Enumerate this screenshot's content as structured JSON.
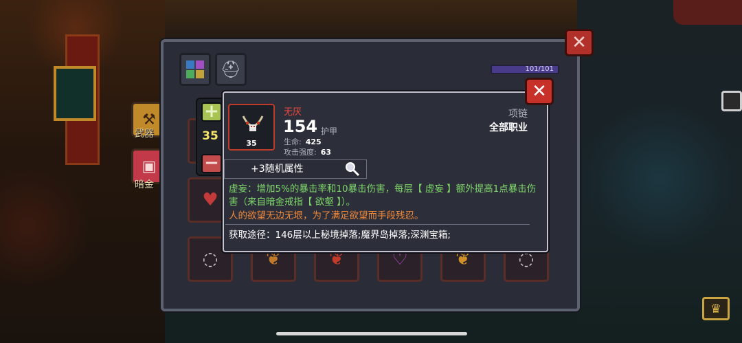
{
  "side_menu": {
    "weapon_label": "武器",
    "dark_gold_label": "暗金"
  },
  "inventory": {
    "capacity_text": "101/101",
    "tabs": [
      {
        "icon": "grid-icon"
      },
      {
        "icon": "helmet-icon"
      }
    ],
    "slot_icons": [
      "necklace-icon",
      "necklace-icon",
      "necklace-icon",
      "necklace-icon",
      "necklace-icon",
      "necklace-icon",
      "heart-necklace-icon"
    ]
  },
  "stepper": {
    "value": "35",
    "plus_symbol": "+",
    "minus_symbol": "−"
  },
  "item": {
    "name": "无厌",
    "level": "35",
    "main_value": "154",
    "main_value_label": "护甲",
    "stats": [
      {
        "label": "生命:",
        "value": "425"
      },
      {
        "label": "攻击强度:",
        "value": "63"
      }
    ],
    "type": "项链",
    "class": "全部职业",
    "random_attributes": "+3随机属性",
    "effect_text": "虚妄：增加5%的暴击率和10暴击伤害，每层【 虚妄 】额外提高1点暴击伤害（来自暗金戒指【 欲壑 】）。",
    "flavor_text": "人的欲望无边无垠，为了满足欲望而手段残忍。",
    "source_text": "获取途径：146层以上秘境掉落;魔界岛掉落;深渊宝箱;"
  },
  "colors": {
    "item_name": "#ef4a3c",
    "effect": "#7fd86a",
    "flavor": "#f0893a",
    "close_button": "#c8302a",
    "stepper_plus": "#a9c254",
    "stepper_minus": "#c24b4b",
    "stepper_value": "#f4e36a",
    "capacity_bar": "#4a3a8a"
  }
}
